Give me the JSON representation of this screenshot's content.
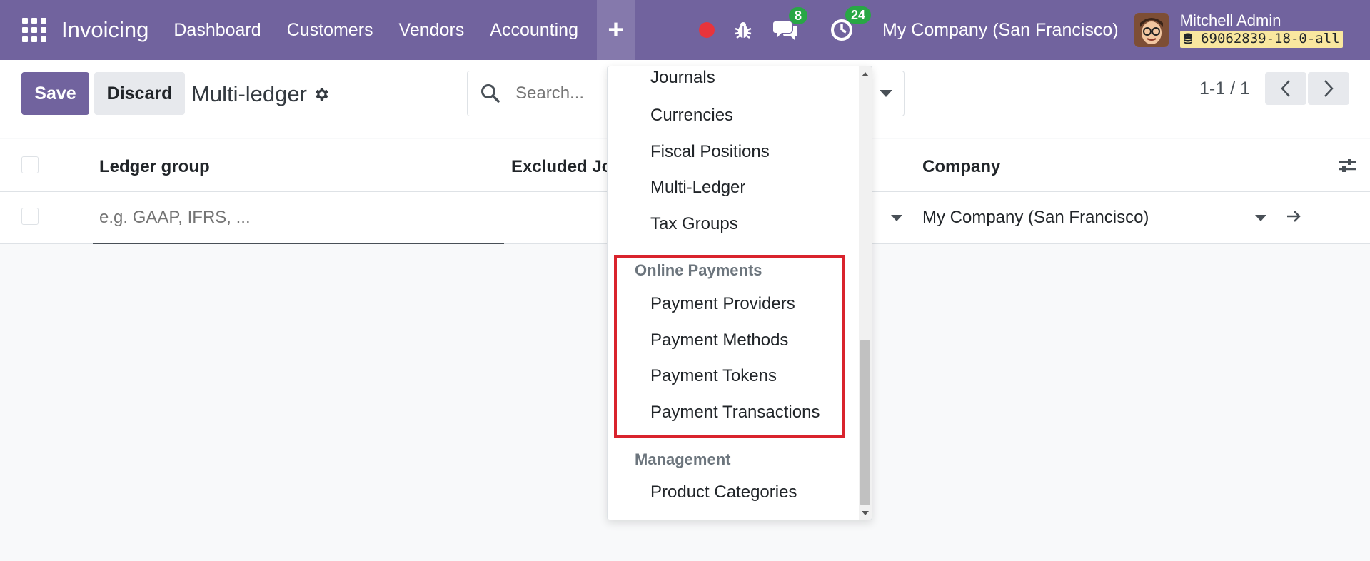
{
  "navbar": {
    "brand": "Invoicing",
    "menu": [
      "Dashboard",
      "Customers",
      "Vendors",
      "Accounting"
    ],
    "plus_label": "+",
    "chat_count": "8",
    "activity_count": "24",
    "company": "My Company (San Francisco)",
    "user_name": "Mitchell Admin",
    "db_name": "69062839-18-0-all",
    "colors": {
      "bar": "#71639e",
      "badge": "#28a745",
      "record": "#e8343b"
    }
  },
  "control": {
    "save_label": "Save",
    "discard_label": "Discard",
    "title": "Multi-ledger",
    "search_placeholder": "Search...",
    "pager_value": "1-1 / 1"
  },
  "list": {
    "columns": [
      "Ledger group",
      "Excluded Jo",
      "Company"
    ],
    "row": {
      "ledger_placeholder": "e.g. GAAP, IFRS, ...",
      "company": "My Company (San Francisco)"
    }
  },
  "dropdown": {
    "items_top": [
      "Journals",
      "Currencies",
      "Fiscal Positions",
      "Multi-Ledger",
      "Tax Groups"
    ],
    "section_online_payments": "Online Payments",
    "items_online_payments": [
      "Payment Providers",
      "Payment Methods",
      "Payment Tokens",
      "Payment Transactions"
    ],
    "section_management": "Management",
    "items_management": [
      "Product Categories"
    ],
    "highlight_color": "#d9232d"
  }
}
